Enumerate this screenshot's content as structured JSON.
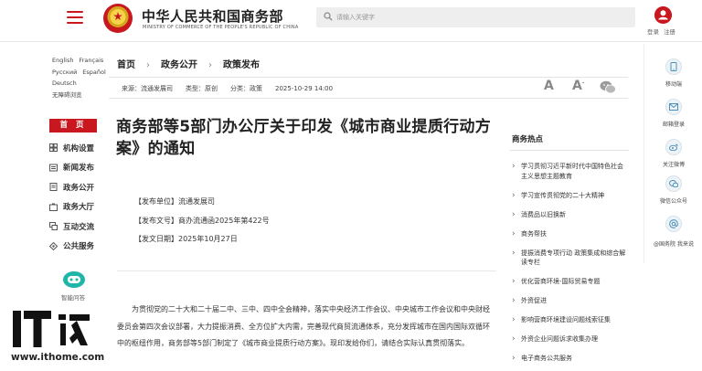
{
  "header": {
    "site_title": "中华人民共和国商务部",
    "site_subtitle": "MINISTRY OF COMMERCE OF THE PEOPLE'S REPUBLIC OF CHINA",
    "search_placeholder": "请输入关键字",
    "login": "登录",
    "register": "注册"
  },
  "languages": {
    "english": "English",
    "francais": "Français",
    "russian": "Русский",
    "espanol": "Español",
    "deutsch": "Deutsch",
    "barrier_free": "无障碍浏览"
  },
  "sidebar": {
    "home": "首 页",
    "items": [
      {
        "label": "机构设置",
        "icon": "building-icon"
      },
      {
        "label": "新闻发布",
        "icon": "news-icon"
      },
      {
        "label": "政务公开",
        "icon": "document-icon"
      },
      {
        "label": "政务大厅",
        "icon": "hall-icon"
      },
      {
        "label": "互动交流",
        "icon": "chat-icon"
      },
      {
        "label": "公共服务",
        "icon": "service-icon"
      }
    ],
    "assistant": "智能问答"
  },
  "watermark": {
    "brand": "IT之家",
    "url": "www.ithome.com"
  },
  "breadcrumb": [
    "首页",
    "政务公开",
    "政策发布"
  ],
  "meta": {
    "source": "来源：流通发展司",
    "type": "类型：原创",
    "category": "分类：政策",
    "datetime": "2025-10-29 14:00"
  },
  "tools": {
    "font_larger": "A",
    "font_smaller": "A",
    "font_smaller_sup": "-"
  },
  "article": {
    "title": "商务部等5部门办公厅关于印发《城市商业提质行动方案》的通知",
    "issuer": "【发布单位】流通发展司",
    "doc_no": "【发布文号】商办流通函2025年第422号",
    "date": "【发文日期】2025年10月27日",
    "body": "为贯彻党的二十大和二十届二中、三中、四中全会精神，落实中央经济工作会议、中央城市工作会议和中央财经委员会第四次会议部署，大力提振消费、全方位扩大内需，完善现代商贸流通体系，充分发挥城市在国内国际双循环中的枢纽作用，商务部等5部门制定了《城市商业提质行动方案》。现印发给你们，请结合实际认真贯彻落实。"
  },
  "hot": {
    "title": "商务热点",
    "items": [
      "学习贯彻习近平新时代中国特色社会主义思想主题教育",
      "学习宣传贯彻党的二十大精神",
      "消费品以旧换新",
      "商务帮扶",
      "提振消费专项行动 政策集成和综合解读专栏",
      "优化营商环境-国际贸易专题",
      "外资促进",
      "影响营商环境建设问题线索征集",
      "外资企业问题诉求收集办理",
      "电子商务公共服务"
    ]
  },
  "right_sidebar": {
    "mobile": "移动端",
    "mail": "邮箱登录",
    "weibo": "关注微博",
    "wechat": "微信公众号",
    "guowuyuan": "@国务院 我来说"
  }
}
